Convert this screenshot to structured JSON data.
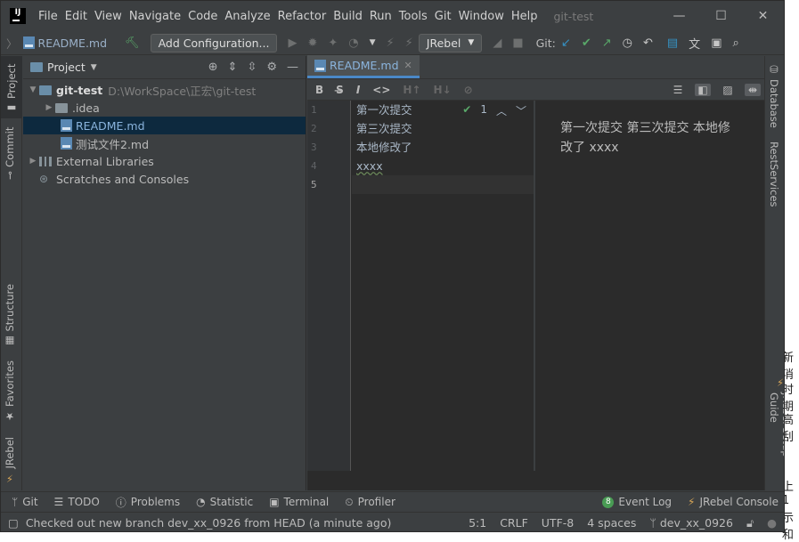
{
  "window_title": "git-test",
  "menu": [
    "File",
    "Edit",
    "View",
    "Navigate",
    "Code",
    "Analyze",
    "Refactor",
    "Build",
    "Run",
    "Tools",
    "Git",
    "Window",
    "Help"
  ],
  "toolbar": {
    "breadcrumb_file": "README.md",
    "add_config": "Add Configuration...",
    "jrebel": "JRebel",
    "git_label": "Git:"
  },
  "left_tabs": {
    "project": "Project",
    "commit": "Commit",
    "structure": "Structure",
    "favorites": "Favorites",
    "jrebel": "JRebel"
  },
  "right_tabs": {
    "database": "Database",
    "rest": "RestServices",
    "jrebel_guide": "JRebel Setup Guide"
  },
  "project_panel": {
    "title": "Project",
    "root": {
      "name": "git-test",
      "path": "D:\\WorkSpace\\正宏\\git-test"
    },
    "items": [
      ".idea",
      "README.md",
      "测试文件2.md",
      "External Libraries",
      "Scratches and Consoles"
    ]
  },
  "editor": {
    "tab": "README.md",
    "line_numbers": [
      "1",
      "2",
      "3",
      "4",
      "5"
    ],
    "lines": [
      "第一次提交",
      "第三次提交",
      "本地修改了",
      "xxxx",
      ""
    ],
    "inspection_count": "1",
    "preview": "第一次提交 第三次提交 本地修改了 xxxx"
  },
  "bottom_tools": {
    "git": "Git",
    "todo": "TODO",
    "problems": "Problems",
    "statistic": "Statistic",
    "terminal": "Terminal",
    "profiler": "Profiler",
    "event_count": "8",
    "event_log": "Event Log",
    "jrebel_console": "JRebel Console"
  },
  "status": {
    "message": "Checked out new branch dev_xx_0926 from HEAD (a minute ago)",
    "position": "5:1",
    "line_sep": "CRLF",
    "encoding": "UTF-8",
    "indent": "4 spaces",
    "branch": "dev_xx_0926"
  },
  "background_text": [
    "新消",
    "时期",
    "高刮",
    "上1",
    "示和"
  ]
}
